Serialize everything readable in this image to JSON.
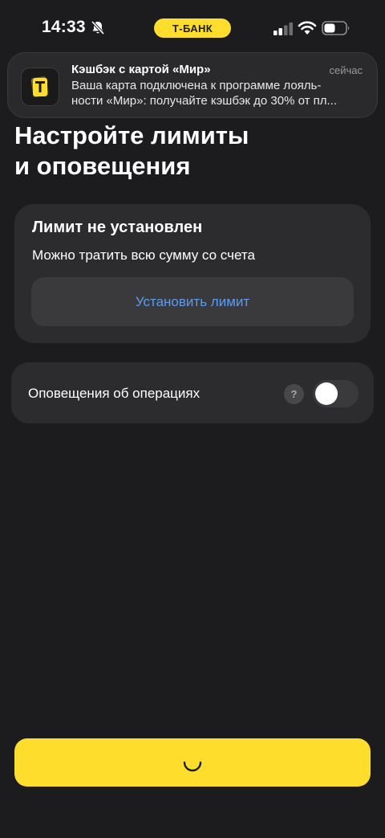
{
  "status_bar": {
    "time": "14:33",
    "bank_badge": "Т-БАНК",
    "icons": [
      "bell-slash-icon",
      "signal-icon",
      "wifi-icon",
      "battery-icon"
    ]
  },
  "notification": {
    "app_icon": "tbank-card-icon",
    "title": "Кэшбэк с картой «Мир»",
    "time": "сейчас",
    "body_line1": "Ваша карта подключена к программе лояль-",
    "body_line2": "ности «Мир»: получайте кэшбэк до 30% от пл..."
  },
  "page": {
    "title_line1": "Настройте лимиты",
    "title_line2": "и оповещения"
  },
  "limit_card": {
    "title": "Лимит не установлен",
    "subtitle": "Можно тратить всю сумму со счета",
    "button_label": "Установить лимит"
  },
  "notifications_card": {
    "label": "Оповещения об операциях",
    "help_label": "?",
    "toggle_on": false
  },
  "primary_button": {
    "state": "loading",
    "icon": "spinner-icon"
  },
  "colors": {
    "background": "#1c1c1e",
    "card": "#2c2c2e",
    "accent_yellow": "#ffdd2d",
    "link_blue": "#5b9cf0"
  }
}
